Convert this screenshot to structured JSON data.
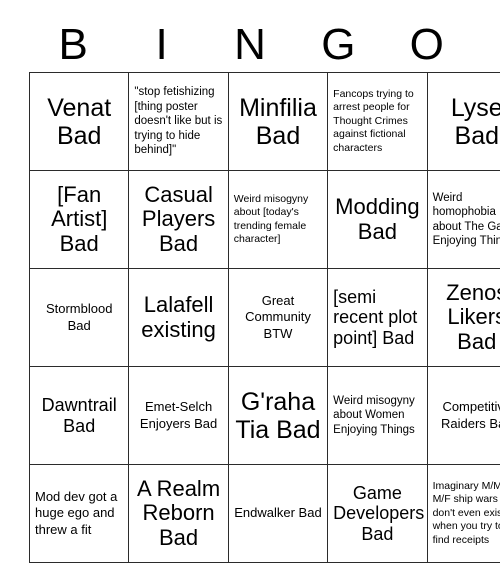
{
  "card": {
    "header_letters": [
      "B",
      "I",
      "N",
      "G",
      "O"
    ],
    "border_color": "#2b2b2b",
    "background_color": "#ffffff",
    "text_color": "#000000",
    "rows": [
      [
        {
          "text": "Venat Bad",
          "size": "xl",
          "align": "center",
          "valign": "middle"
        },
        {
          "text": "\"stop fetishizing [thing poster doesn't like but is trying to hide behind]\"",
          "size": "xs",
          "align": "left",
          "valign": "top"
        },
        {
          "text": "Minfilia Bad",
          "size": "xl",
          "align": "center",
          "valign": "middle"
        },
        {
          "text": "Fancops trying to arrest people for Thought Crimes against fictional characters",
          "size": "xxs",
          "align": "left",
          "valign": "top"
        },
        {
          "text": "Lyse Bad",
          "size": "xl",
          "align": "center",
          "valign": "middle"
        }
      ],
      [
        {
          "text": "[Fan Artist] Bad",
          "size": "lg",
          "align": "center",
          "valign": "middle"
        },
        {
          "text": "Casual Players Bad",
          "size": "lg",
          "align": "center",
          "valign": "middle"
        },
        {
          "text": "Weird misogyny about [today's trending female character]",
          "size": "xxs",
          "align": "left",
          "valign": "middle"
        },
        {
          "text": "Modding Bad",
          "size": "lg",
          "align": "center",
          "valign": "middle"
        },
        {
          "text": "Weird homophobia about The Gays Enjoying Things",
          "size": "xs",
          "align": "left",
          "valign": "middle"
        }
      ],
      [
        {
          "text": "Stormblood Bad",
          "size": "sm",
          "align": "center",
          "valign": "middle"
        },
        {
          "text": "Lalafell existing",
          "size": "lg",
          "align": "center",
          "valign": "middle"
        },
        {
          "text": "Great Community BTW",
          "size": "sm",
          "align": "center",
          "valign": "middle"
        },
        {
          "text": "[semi recent plot point] Bad",
          "size": "md",
          "align": "left",
          "valign": "middle"
        },
        {
          "text": "Zenos Likers Bad",
          "size": "lg",
          "align": "center",
          "valign": "middle"
        }
      ],
      [
        {
          "text": "Dawntrail Bad",
          "size": "md",
          "align": "center",
          "valign": "middle"
        },
        {
          "text": "Emet-Selch Enjoyers Bad",
          "size": "sm",
          "align": "center",
          "valign": "middle"
        },
        {
          "text": "G'raha Tia Bad",
          "size": "xl",
          "align": "center",
          "valign": "middle"
        },
        {
          "text": "Weird misogyny about Women Enjoying Things",
          "size": "xs",
          "align": "left",
          "valign": "middle"
        },
        {
          "text": "Competitive Raiders Bad",
          "size": "sm",
          "align": "center",
          "valign": "middle"
        }
      ],
      [
        {
          "text": "Mod dev got a huge ego and threw a fit",
          "size": "sm",
          "align": "left",
          "valign": "middle"
        },
        {
          "text": "A Realm Reborn Bad",
          "size": "lg",
          "align": "center",
          "valign": "middle"
        },
        {
          "text": "Endwalker Bad",
          "size": "sm",
          "align": "center",
          "valign": "middle"
        },
        {
          "text": "Game Developers Bad",
          "size": "md",
          "align": "center",
          "valign": "middle"
        },
        {
          "text": "Imaginary M/M vs M/F ship wars that don't even exist when you try to find receipts",
          "size": "xxs",
          "align": "left",
          "valign": "middle"
        }
      ]
    ]
  }
}
